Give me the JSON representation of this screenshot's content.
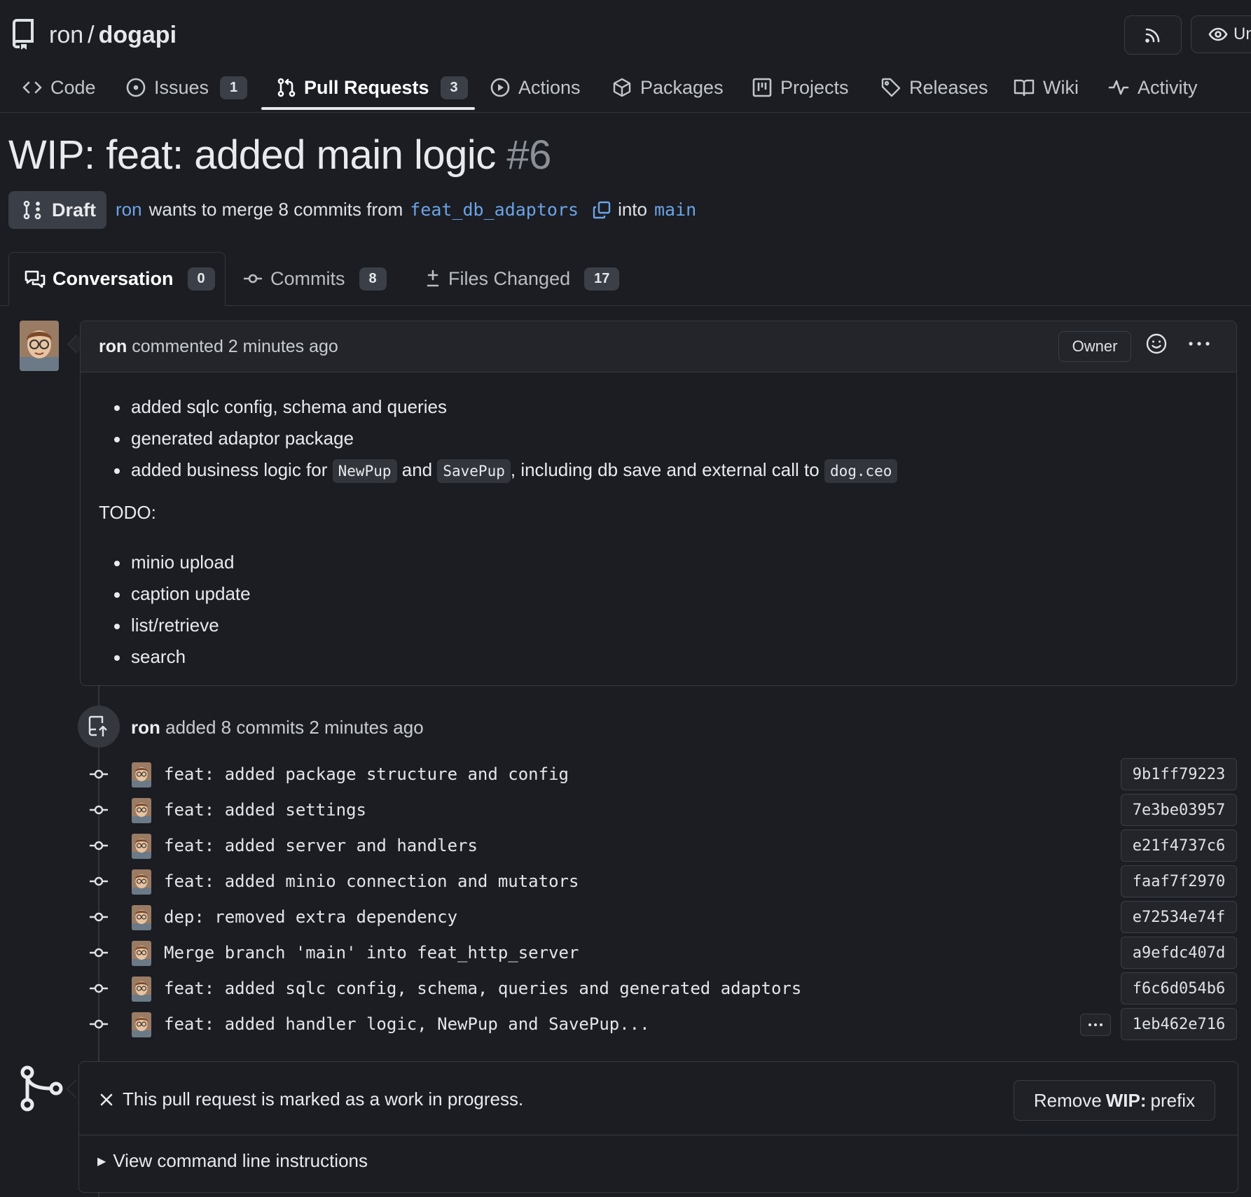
{
  "repo": {
    "owner": "ron",
    "slash": "/",
    "name": "dogapi"
  },
  "header_buttons": {
    "watch_label": "Un"
  },
  "nav": {
    "code": "Code",
    "issues": "Issues",
    "issues_count": "1",
    "pulls": "Pull Requests",
    "pulls_count": "3",
    "actions": "Actions",
    "packages": "Packages",
    "projects": "Projects",
    "releases": "Releases",
    "wiki": "Wiki",
    "activity": "Activity"
  },
  "pr": {
    "title": "WIP: feat: added main logic",
    "number": "#6",
    "status": "Draft",
    "author": "ron",
    "merge_text": "wants to merge 8 commits from",
    "head_branch": "feat_db_adaptors",
    "into_text": "into",
    "base_branch": "main"
  },
  "tabs": {
    "conversation": "Conversation",
    "conversation_count": "0",
    "commits": "Commits",
    "commits_count": "8",
    "files": "Files Changed",
    "files_count": "17"
  },
  "comment": {
    "author": "ron",
    "action": "commented 2 minutes ago",
    "role": "Owner",
    "list1": [
      "added sqlc config, schema and queries",
      "generated adaptor package"
    ],
    "list1_item3": {
      "pre": "added business logic for",
      "code1": "NewPup",
      "mid": "and",
      "code2": "SavePup",
      "post": ", including db save and external call to",
      "code3": "dog.ceo"
    },
    "todo_label": "TODO:",
    "todo_items": [
      "minio upload",
      "caption update",
      "list/retrieve",
      "search"
    ]
  },
  "push_event": {
    "author": "ron",
    "text": "added 8 commits 2 minutes ago"
  },
  "commits": [
    {
      "message": "feat: added package structure and config",
      "sha": "9b1ff79223"
    },
    {
      "message": "feat: added settings",
      "sha": "7e3be03957"
    },
    {
      "message": "feat: added server and handlers",
      "sha": "e21f4737c6"
    },
    {
      "message": "feat: added minio connection and mutators",
      "sha": "faaf7f2970"
    },
    {
      "message": "dep: removed extra dependency",
      "sha": "e72534e74f"
    },
    {
      "message": "Merge branch 'main' into feat_http_server",
      "sha": "a9efdc407d"
    },
    {
      "message": "feat: added sqlc config, schema, queries and generated adaptors",
      "sha": "f6c6d054b6"
    },
    {
      "message": "feat: added handler logic, NewPup and SavePup...",
      "sha": "1eb462e716"
    }
  ],
  "merge_box": {
    "wip_message": "This pull request is marked as a work in progress.",
    "remove_pre": "Remove",
    "remove_bold": "WIP:",
    "remove_post": "prefix",
    "cli_label": "View command line instructions"
  },
  "colors": {
    "bg": "#1b1d22",
    "link": "#6ca3e6",
    "border": "#363941"
  }
}
